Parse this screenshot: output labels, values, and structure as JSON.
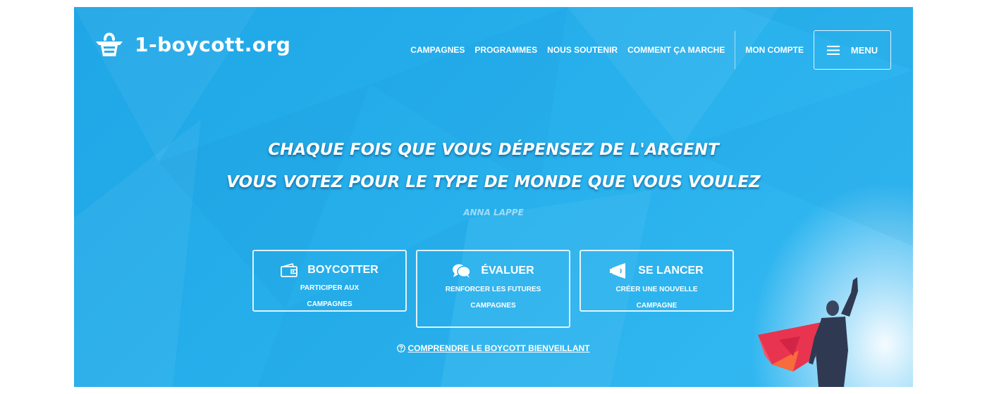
{
  "header": {
    "logo_text": "1-boycott.org",
    "nav": {
      "campagnes": "CAMPAGNES",
      "programmes": "PROGRAMMES",
      "soutenir": "NOUS SOUTENIR",
      "comment": "COMMENT ÇA MARCHE",
      "compte": "MON COMPTE"
    },
    "menu_label": "MENU"
  },
  "hero": {
    "quote_line1": "CHAQUE FOIS QUE VOUS DÉPENSEZ DE L'ARGENT",
    "quote_line2": "VOUS VOTEZ POUR LE TYPE DE MONDE QUE VOUS VOULEZ",
    "author": "ANNA LAPPE"
  },
  "actions": [
    {
      "title": "BOYCOTTER",
      "subtitle": "PARTICIPER AUX CAMPAGNES",
      "icon": "wallet-icon"
    },
    {
      "title": "ÉVALUER",
      "subtitle": "RENFORCER LES FUTURES CAMPAGNES",
      "icon": "chat-bubbles-icon"
    },
    {
      "title": "SE LANCER",
      "subtitle": "CRÉER UNE NOUVELLE CAMPAGNE",
      "icon": "megaphone-icon"
    }
  ],
  "understand_link": "COMPRENDRE LE BOYCOTT BIENVEILLANT",
  "colors": {
    "hero_blue": "#27b0ec",
    "text": "#ffffff",
    "cape_red": "#e8344e",
    "figure_dark": "#2f3a52"
  }
}
